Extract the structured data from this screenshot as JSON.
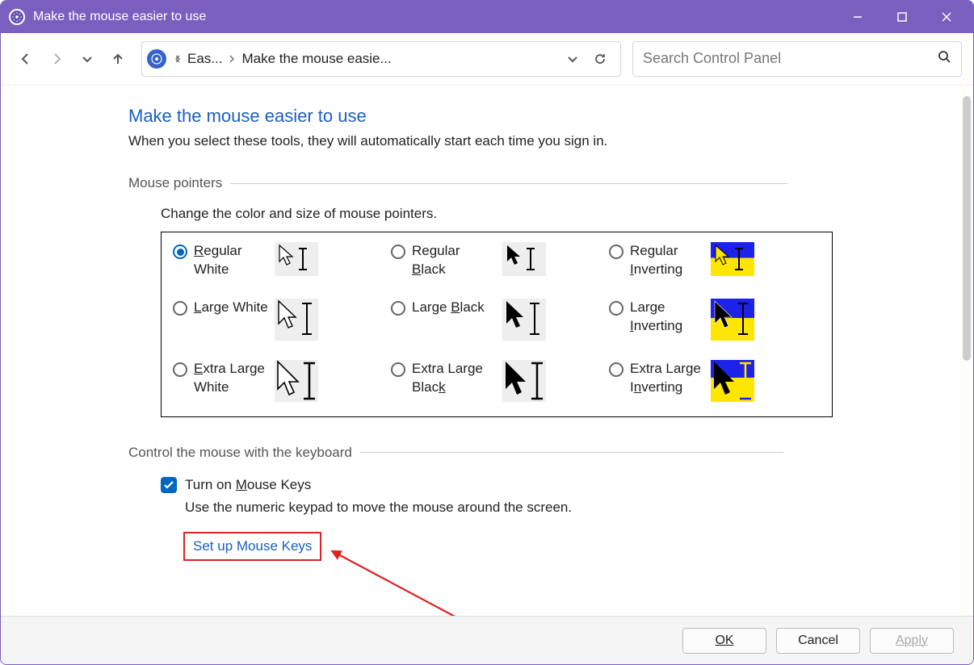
{
  "window": {
    "title": "Make the mouse easier to use"
  },
  "nav": {
    "breadcrumb_prev": "Eas...",
    "breadcrumb_current": "Make the mouse easie...",
    "search_placeholder": "Search Control Panel"
  },
  "main": {
    "heading": "Make the mouse easier to use",
    "subtitle": "When you select these tools, they will automatically start each time you sign in.",
    "pointers_section": "Mouse pointers",
    "pointers_hint": "Change the color and size of mouse pointers.",
    "options": {
      "rw1": "R",
      "rw2": "egular White",
      "rb1": "Regular ",
      "rb2": "B",
      "rb3": "lack",
      "ri1": "Regular ",
      "ri2": "I",
      "ri3": "nverting",
      "lw1": "L",
      "lw2": "arge White",
      "lb1": "Large ",
      "lb2": "B",
      "lb3": "lack",
      "li1": "Large ",
      "li2": "I",
      "li3": "nverting",
      "xw1": "E",
      "xw2": "xtra Large White",
      "xb1": "Extra Large Blac",
      "xb2": "k",
      "xi1": "Extra Large I",
      "xi2": "n",
      "xi3": "verting"
    },
    "keyboard_section": "Control the mouse with the keyboard",
    "mouse_keys_pre": "Turn on ",
    "mouse_keys_mn": "M",
    "mouse_keys_post": "ouse Keys",
    "mouse_keys_desc": "Use the numeric keypad to move the mouse around the screen.",
    "setup_link": "Set up Mouse Keys"
  },
  "footer": {
    "ok": "OK",
    "cancel": "Cancel",
    "apply": "Apply"
  }
}
